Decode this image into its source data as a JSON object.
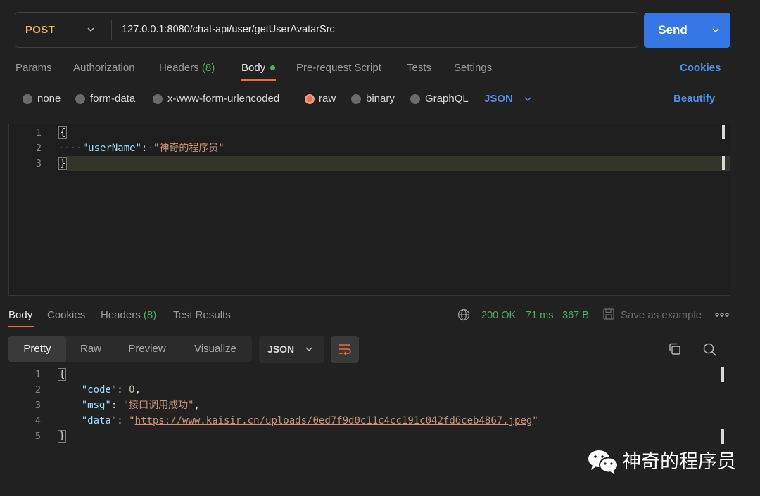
{
  "request": {
    "method": "POST",
    "url": "127.0.0.1:8080/chat-api/user/getUserAvatarSrc",
    "send_label": "Send"
  },
  "request_tabs": {
    "params": "Params",
    "authorization": "Authorization",
    "headers": "Headers",
    "headers_count": "(8)",
    "body": "Body",
    "prerequest": "Pre-request Script",
    "tests": "Tests",
    "settings": "Settings",
    "cookies": "Cookies"
  },
  "body_types": {
    "none": "none",
    "form_data": "form-data",
    "urlencoded": "x-www-form-urlencoded",
    "raw": "raw",
    "binary": "binary",
    "graphql": "GraphQL",
    "selected": "raw",
    "format": "JSON",
    "beautify": "Beautify"
  },
  "request_editor": {
    "line_numbers": [
      "1",
      "2",
      "3"
    ],
    "open_brace": "{",
    "close_brace": "}",
    "key": "\"userName\"",
    "colon": ":",
    "value": "\"神奇的程序员\""
  },
  "response_tabs": {
    "body": "Body",
    "cookies": "Cookies",
    "headers": "Headers",
    "headers_count": "(8)",
    "test_results": "Test Results"
  },
  "response_status": {
    "status": "200 OK",
    "time": "71 ms",
    "size": "367 B",
    "save_as_example": "Save as example"
  },
  "response_view": {
    "pretty": "Pretty",
    "raw": "Raw",
    "preview": "Preview",
    "visualize": "Visualize",
    "format": "JSON"
  },
  "response_editor": {
    "line_numbers": [
      "1",
      "2",
      "3",
      "4",
      "5"
    ],
    "open_brace": "{",
    "close_brace": "}",
    "code_key": "\"code\"",
    "code_value": "0",
    "msg_key": "\"msg\"",
    "msg_value": "\"接口调用成功\"",
    "data_key": "\"data\"",
    "data_quote": "\"",
    "data_url": "https://www.kaisir.cn/uploads/0ed7f9d0c11c4cc191c042fd6ceb4867.jpeg"
  },
  "watermark": {
    "text": "神奇的程序员"
  },
  "colors": {
    "accent": "#f26b3a",
    "link": "#4f8fe8",
    "send": "#3578e5",
    "success": "#4fad63",
    "method": "#eab75b"
  },
  "icons": {
    "method_dropdown": "chevron-down-icon",
    "send_dropdown": "chevron-down-icon",
    "format_dropdown": "chevron-down-icon",
    "globe": "globe-icon",
    "save": "save-icon",
    "more": "more-horizontal-icon",
    "wrap": "word-wrap-icon",
    "copy": "copy-icon",
    "search": "search-icon",
    "watermark_logo": "wechat-logo-icon"
  }
}
